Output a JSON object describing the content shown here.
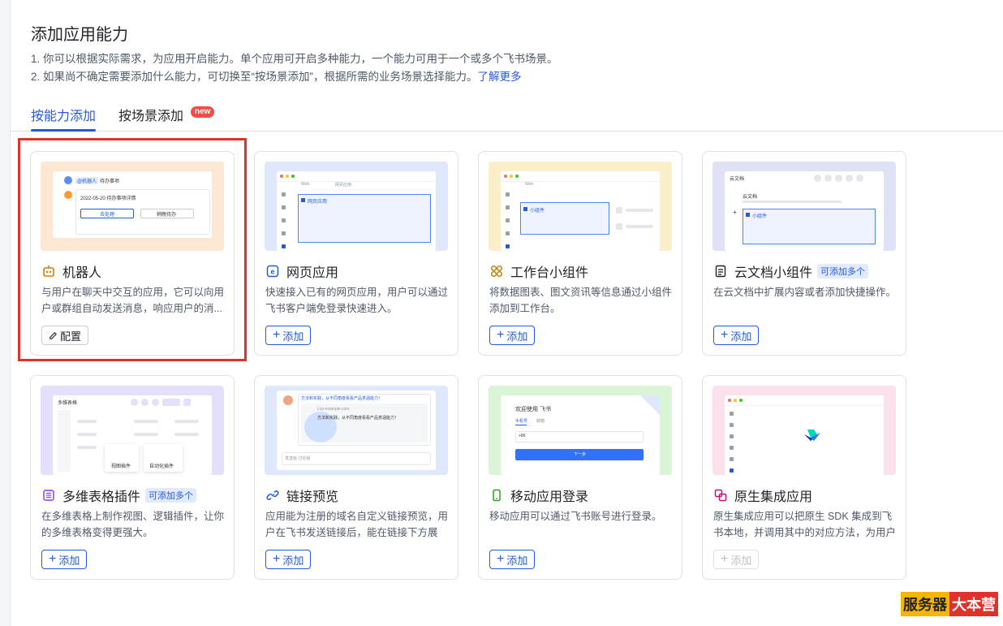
{
  "header": {
    "title": "添加应用能力",
    "desc1": "1. 你可以根据实际需求，为应用开启能力。单个应用可开启多种能力，一个能力可用于一个或多个飞书场景。",
    "desc2": "2. 如果尚不确定需要添加什么能力，可切换至“按场景添加”，根据所需的业务场景选择能力。",
    "learn_more": "了解更多"
  },
  "tabs": {
    "by_capability": "按能力添加",
    "by_scenario": "按场景添加",
    "new_badge": "new"
  },
  "cards": [
    {
      "title": "机器人",
      "desc": "与用户在聊天中交互的应用，它可以向用户或群组自动发送消息，响应用户的消...",
      "button": "配置",
      "icon": "robot-icon"
    },
    {
      "title": "网页应用",
      "desc": "快速接入已有的网页应用，用户可以通过飞书客户端免登录快速进入。",
      "button": "添加",
      "icon": "web-e-icon"
    },
    {
      "title": "工作台小组件",
      "desc": "将数据图表、图文资讯等信息通过小组件添加到工作台。",
      "button": "添加",
      "icon": "widget-grid-icon"
    },
    {
      "title": "云文档小组件",
      "badge": "可添加多个",
      "desc": "在云文档中扩展内容或者添加快捷操作。",
      "button": "添加",
      "icon": "doc-icon"
    },
    {
      "title": "多维表格插件",
      "badge": "可添加多个",
      "desc": "在多维表格上制作视图、逻辑插件，让你的多维表格变得更强大。",
      "button": "添加",
      "icon": "bitable-icon"
    },
    {
      "title": "链接预览",
      "desc": "应用能为注册的域名自定义链接预览，用户在飞书发送链接后，能在链接下方展示...",
      "button": "添加",
      "icon": "link-icon"
    },
    {
      "title": "移动应用登录",
      "desc": "移动应用可以通过飞书账号进行登录。",
      "button": "添加",
      "icon": "mobile-icon"
    },
    {
      "title": "原生集成应用",
      "desc": "原生集成应用可以把原生 SDK 集成到飞书本地，并调用其中的对应方法，为用户提...",
      "button": "添加",
      "disabled": true,
      "icon": "native-app-icon"
    }
  ],
  "thumbs": {
    "robot": {
      "mention": "@机器人",
      "todo": "待办事项",
      "date_line": "2022-05-20 待办事项详情",
      "btn1": "去处理",
      "btn2": "稍晚待办"
    },
    "web": {
      "tab1": "Web",
      "tab2": "网页应用",
      "panel": "网页应用"
    },
    "widget": {
      "tab": "Web",
      "panel": "小组件"
    },
    "doc": {
      "header": "云文档",
      "sub": "云文档",
      "panel": "小组件"
    },
    "bitable": {
      "header": "多维表格",
      "btn1": "视图插件",
      "btn2": "自动化插件"
    },
    "linkpreview": {
      "msg": "方法和实践，从不同角度看看产品意涵能力！",
      "domain": "Lcp-example.com",
      "card_text": "方法和实践，从不同角度看看产品意涵能力！",
      "input": "发送给 讨论组"
    },
    "mobile": {
      "welcome": "欢迎使用 飞书",
      "tab1": "手机号",
      "tab2": "邮箱",
      "prefix": "+86",
      "next": "下一步"
    }
  },
  "watermark": {
    "part1": "服务器",
    "part2": "大本营"
  },
  "colors": {
    "accent": "#245bdb",
    "highlight": "#e0312b",
    "new_badge": "#f54a45"
  }
}
